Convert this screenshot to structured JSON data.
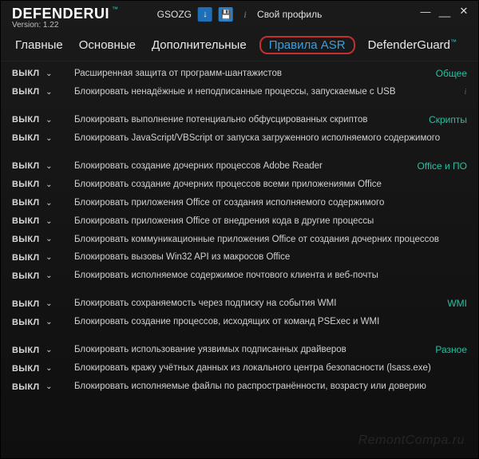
{
  "brand": {
    "name_main": "DEFENDER",
    "name_suffix": "UI",
    "tm": "™",
    "version_label": "Version: 1.22"
  },
  "header": {
    "user": "GSOZG",
    "download_icon": "↓",
    "save_icon": "💾",
    "info_icon": "i",
    "profile_label": "Свой профиль",
    "win_min": "—",
    "win_line": "__",
    "win_close": "✕"
  },
  "tabs": {
    "items": [
      {
        "label": "Главные",
        "active": false
      },
      {
        "label": "Основные",
        "active": false
      },
      {
        "label": "Дополнительные",
        "active": false
      },
      {
        "label": "Правила ASR",
        "active": true
      },
      {
        "label": "DefenderGuard",
        "active": false,
        "tm": "™"
      }
    ]
  },
  "toggle_state": "ВЫКЛ",
  "chevron": "⌄",
  "groups": [
    {
      "name": "Общее",
      "rules": [
        {
          "text": "Расширенная защита от программ-шантажистов"
        },
        {
          "text": "Блокировать ненадёжные и неподписанные процессы, запускаемые с USB",
          "info": true
        }
      ]
    },
    {
      "name": "Скрипты",
      "rules": [
        {
          "text": "Блокировать выполнение потенциально обфусцированных скриптов"
        },
        {
          "text": "Блокировать JavaScript/VBScript от запуска загруженного исполняемого содержимого"
        }
      ]
    },
    {
      "name": "Office и ПО",
      "rules": [
        {
          "text": "Блокировать создание дочерних процессов Adobe Reader"
        },
        {
          "text": "Блокировать создание дочерних процессов всеми приложениями Office"
        },
        {
          "text": "Блокировать приложения Office от создания исполняемого содержимого"
        },
        {
          "text": "Блокировать приложения Office от внедрения кода в другие процессы"
        },
        {
          "text": "Блокировать коммуникационные приложения Office от создания дочерних процессов"
        },
        {
          "text": "Блокировать вызовы Win32 API из макросов Office"
        },
        {
          "text": "Блокировать исполняемое содержимое почтового клиента и веб-почты"
        }
      ]
    },
    {
      "name": "WMI",
      "rules": [
        {
          "text": "Блокировать сохраняемость через подписку на события WMI"
        },
        {
          "text": "Блокировать создание процессов, исходящих от команд PSExec и WMI"
        }
      ]
    },
    {
      "name": "Разное",
      "rules": [
        {
          "text": "Блокировать использование уязвимых подписанных драйверов"
        },
        {
          "text": "Блокировать кражу учётных данных из локального центра безопасности (lsass.exe)"
        },
        {
          "text": "Блокировать исполняемые файлы по распространённости, возрасту или доверию"
        }
      ]
    }
  ],
  "watermark": "RemontCompa.ru"
}
